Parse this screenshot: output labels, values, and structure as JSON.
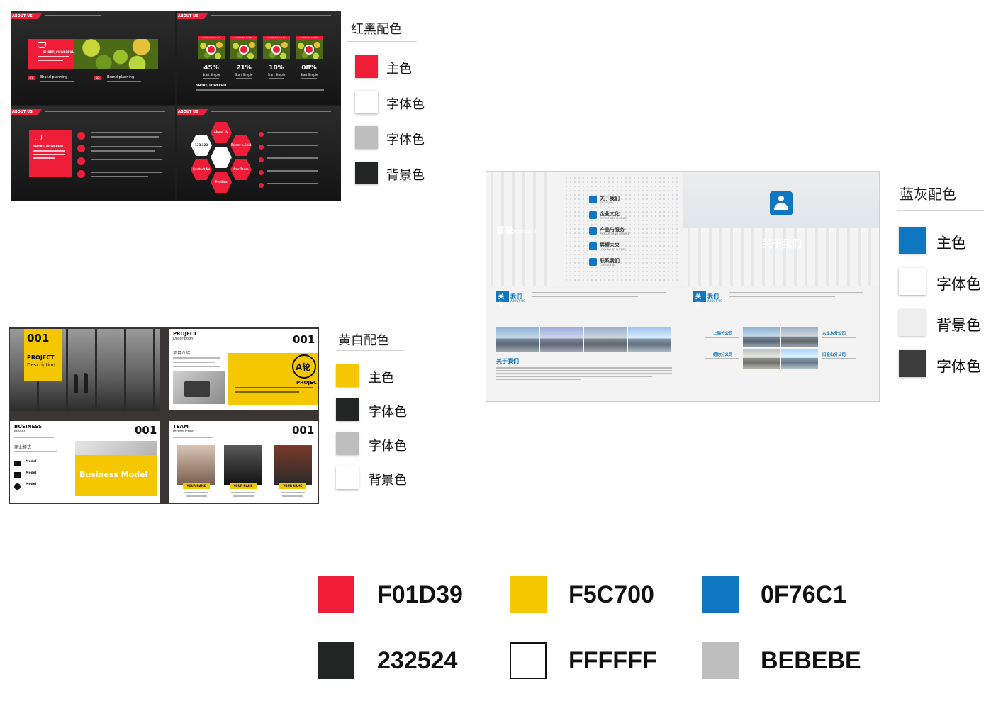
{
  "red_black": {
    "title": "红黑配色",
    "items": [
      {
        "label": "主色",
        "color": "#F01D39"
      },
      {
        "label": "字体色",
        "color": "#FFFFFF"
      },
      {
        "label": "字体色",
        "color": "#BEBEBE"
      },
      {
        "label": "背景色",
        "color": "#232524"
      }
    ],
    "slides": {
      "tag": "ABOUT US",
      "short_powerful": "SHORT/ POWERFUL",
      "brand_planning": "Brand planning",
      "num_01": "01",
      "num_02": "02",
      "company_sales": "COMPANY SALES",
      "percents": [
        "45%",
        "21%",
        "10%",
        "08%"
      ],
      "start_simple": "Start Simple",
      "hex_labels": [
        "About Us",
        "Talent s.Skill",
        "Our Team",
        "Profiles",
        "Contact Us"
      ],
      "hex_center": "133,123"
    }
  },
  "blue_gray": {
    "title": "蓝灰配色",
    "items": [
      {
        "label": "主色",
        "color": "#0F76C1"
      },
      {
        "label": "字体色",
        "color": "#FFFFFF"
      },
      {
        "label": "背景色",
        "color": "#EFEFEF"
      },
      {
        "label": "字体色",
        "color": "#3C3C3C"
      }
    ],
    "slides": {
      "contents": "目录",
      "contents_en": "/content",
      "menu": [
        {
          "cn": "关于我们",
          "en": "ABOUT US"
        },
        {
          "cn": "企业文化",
          "en": "ENTERPRISE CULTURE"
        },
        {
          "cn": "产品与服务",
          "en": "PRODUCT AND SERVICE"
        },
        {
          "cn": "展望未来",
          "en": "LOOKING TO FUTURE"
        },
        {
          "cn": "联系我们",
          "en": "CONTACT US"
        }
      ],
      "about_cn": "关于我们",
      "about_en": "ABOUT US",
      "about_tag": "关于",
      "about_tag2": "我们",
      "branches": [
        "上海分公司",
        "六本木分公司",
        "纽约分公司",
        "旧金山分公司"
      ]
    }
  },
  "yellow_white": {
    "title": "黄白配色",
    "items": [
      {
        "label": "主色",
        "color": "#F5C700"
      },
      {
        "label": "字体色",
        "color": "#232524"
      },
      {
        "label": "字体色",
        "color": "#BEBEBE"
      },
      {
        "label": "背景色",
        "color": "#FFFFFF"
      }
    ],
    "slides": {
      "num": "001",
      "project": "PROJECT",
      "description": "Description",
      "project_cn": "项目介绍",
      "round": "A轮",
      "business": "BUSINESS",
      "model": "Model",
      "business_cn": "商业模式",
      "business_model": "Business Model",
      "model_label": "Model",
      "team": "TEAM",
      "introduction": "Introduction",
      "your_name": "YOUR NAME"
    }
  },
  "codes": [
    {
      "hex": "F01D39",
      "color": "#F01D39"
    },
    {
      "hex": "F5C700",
      "color": "#F5C700"
    },
    {
      "hex": "0F76C1",
      "color": "#0F76C1"
    },
    {
      "hex": "232524",
      "color": "#232524"
    },
    {
      "hex": "FFFFFF",
      "color": "#FFFFFF"
    },
    {
      "hex": "BEBEBE",
      "color": "#BEBEBE"
    }
  ]
}
